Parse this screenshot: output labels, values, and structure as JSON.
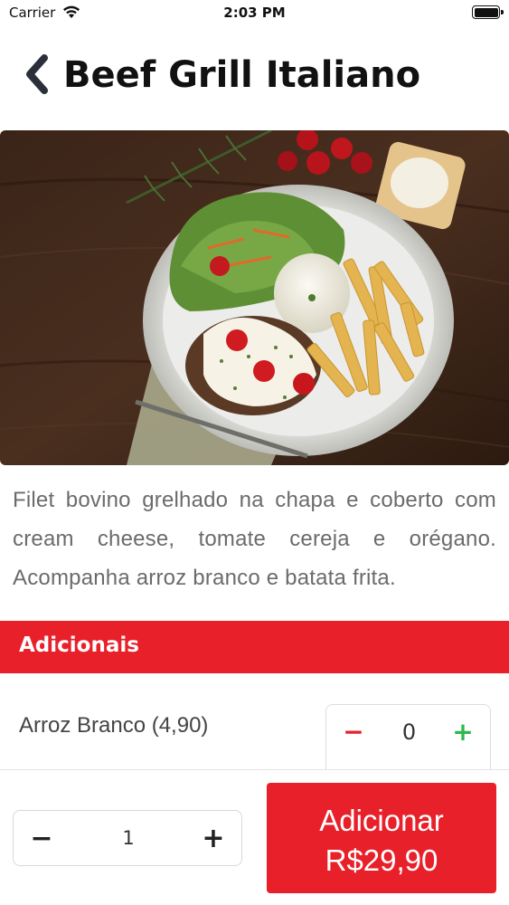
{
  "status_bar": {
    "carrier": "Carrier",
    "time": "2:03 PM",
    "wifi_icon": "wifi-icon",
    "battery_icon": "battery-icon"
  },
  "header": {
    "back_icon": "chevron-left-icon",
    "title": "Beef Grill Italiano"
  },
  "dish": {
    "image": "dish-photo",
    "description": "Filet bovino grelhado na chapa e coberto com cream cheese, tomate cereja e orégano. Acompanha arroz branco e batata frita."
  },
  "addons": {
    "title": "Adicionais",
    "items": [
      {
        "label": "Arroz Branco (4,90)",
        "minus": "−",
        "quantity": "0",
        "plus": "+"
      }
    ]
  },
  "order": {
    "minus": "−",
    "quantity": "1",
    "plus": "+",
    "button_label": "Adicionar",
    "button_price": "R$29,90"
  },
  "colors": {
    "accent_red": "#e8202a",
    "plus_green": "#2db84d",
    "text_gray": "#6b6b6b"
  }
}
